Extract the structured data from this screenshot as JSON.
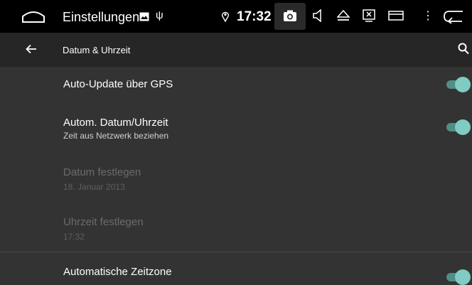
{
  "status_bar": {
    "app_title": "Einstellungen",
    "time": "17:32",
    "icons": [
      "home-icon",
      "image-icon",
      "usb-icon",
      "location-icon",
      "camera-icon",
      "volume-icon",
      "eject-icon",
      "screen-x-icon",
      "window-icon",
      "more-icon",
      "back-icon"
    ]
  },
  "toolbar": {
    "title": "Datum & Uhrzeit",
    "icons": [
      "arrow-back-icon",
      "search-icon"
    ]
  },
  "settings": [
    {
      "label": "Auto-Update über GPS",
      "toggle": true
    },
    {
      "label": "Autom. Datum/Uhrzeit",
      "sub": "Zeit aus Netzwerk beziehen",
      "toggle": true
    },
    {
      "label": "Datum festlegen",
      "sub": "18. Januar 2013",
      "enabled": false
    },
    {
      "label": "Uhrzeit festlegen",
      "sub": "17:32",
      "enabled": false
    },
    {
      "label": "Automatische Zeitzone",
      "toggle": true
    }
  ],
  "colors": {
    "status_bar_bg": "#000000",
    "toolbar_bg": "#262626",
    "content_bg": "#333333",
    "switch_thumb": "#80cbc4",
    "switch_track": "#4f8f86",
    "disabled_text": "#6b6b6b"
  }
}
